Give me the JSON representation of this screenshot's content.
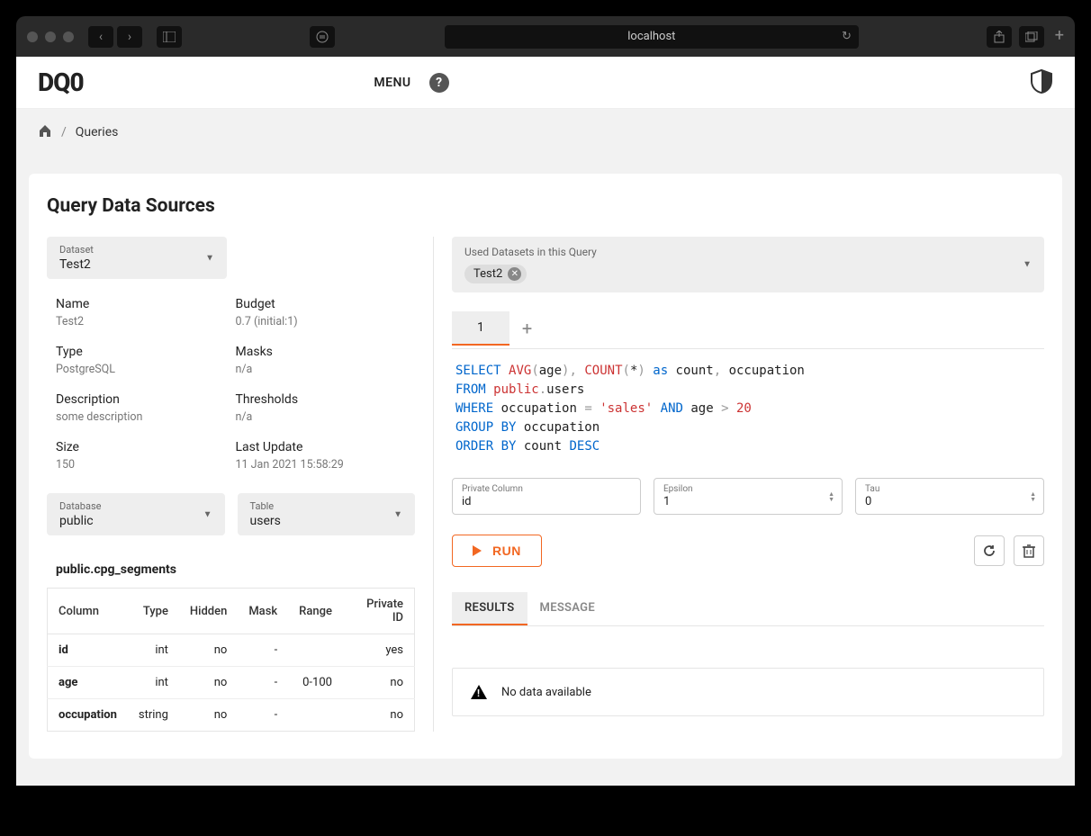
{
  "browser": {
    "url": "localhost"
  },
  "header": {
    "logo": "DQ0",
    "menu": "MENU"
  },
  "breadcrumb": {
    "current": "Queries"
  },
  "page_title": "Query Data Sources",
  "dataset_select": {
    "label": "Dataset",
    "value": "Test2"
  },
  "meta": {
    "name": {
      "label": "Name",
      "value": "Test2"
    },
    "budget": {
      "label": "Budget",
      "value": "0.7 (initial:1)"
    },
    "type": {
      "label": "Type",
      "value": "PostgreSQL"
    },
    "masks": {
      "label": "Masks",
      "value": "n/a"
    },
    "description": {
      "label": "Description",
      "value": "some description"
    },
    "thresholds": {
      "label": "Thresholds",
      "value": "n/a"
    },
    "size": {
      "label": "Size",
      "value": "150"
    },
    "last_update": {
      "label": "Last Update",
      "value": "11 Jan 2021 15:58:29"
    }
  },
  "db_select": {
    "label": "Database",
    "value": "public"
  },
  "table_select": {
    "label": "Table",
    "value": "users"
  },
  "schema_title": "public.cpg_segments",
  "schema_headers": [
    "Column",
    "Type",
    "Hidden",
    "Mask",
    "Range",
    "Private ID"
  ],
  "schema_rows": [
    {
      "c": "id",
      "t": "int",
      "h": "no",
      "m": "-",
      "r": "",
      "p": "yes"
    },
    {
      "c": "age",
      "t": "int",
      "h": "no",
      "m": "-",
      "r": "0-100",
      "p": "no"
    },
    {
      "c": "occupation",
      "t": "string",
      "h": "no",
      "m": "-",
      "r": "",
      "p": "no"
    }
  ],
  "used_datasets": {
    "label": "Used Datasets in this Query",
    "chips": [
      "Test2"
    ]
  },
  "query_tabs": [
    "1"
  ],
  "sql_tokens": [
    [
      "kw",
      "SELECT"
    ],
    [
      "sp",
      " "
    ],
    [
      "fn",
      "AVG"
    ],
    [
      "punc",
      "("
    ],
    [
      "txt",
      "age"
    ],
    [
      "punc",
      ")"
    ],
    [
      "punc",
      ","
    ],
    [
      "sp",
      " "
    ],
    [
      "fn",
      "COUNT"
    ],
    [
      "punc",
      "("
    ],
    [
      "txt",
      "*"
    ],
    [
      "punc",
      ")"
    ],
    [
      "sp",
      " "
    ],
    [
      "kw",
      "as"
    ],
    [
      "sp",
      " "
    ],
    [
      "txt",
      "count"
    ],
    [
      "punc",
      ","
    ],
    [
      "sp",
      " "
    ],
    [
      "txt",
      "occupation"
    ],
    [
      "nl"
    ],
    [
      "kw",
      "FROM"
    ],
    [
      "sp",
      " "
    ],
    [
      "fn",
      "public"
    ],
    [
      "punc",
      "."
    ],
    [
      "txt",
      "users"
    ],
    [
      "nl"
    ],
    [
      "kw",
      "WHERE"
    ],
    [
      "sp",
      " "
    ],
    [
      "txt",
      "occupation"
    ],
    [
      "sp",
      " "
    ],
    [
      "punc",
      "="
    ],
    [
      "sp",
      " "
    ],
    [
      "str",
      "'sales'"
    ],
    [
      "sp",
      " "
    ],
    [
      "kw",
      "AND"
    ],
    [
      "sp",
      " "
    ],
    [
      "txt",
      "age"
    ],
    [
      "sp",
      " "
    ],
    [
      "punc",
      ">"
    ],
    [
      "sp",
      " "
    ],
    [
      "num",
      "20"
    ],
    [
      "nl"
    ],
    [
      "kw",
      "GROUP"
    ],
    [
      "sp",
      " "
    ],
    [
      "kw",
      "BY"
    ],
    [
      "sp",
      " "
    ],
    [
      "txt",
      "occupation"
    ],
    [
      "nl"
    ],
    [
      "kw",
      "ORDER"
    ],
    [
      "sp",
      " "
    ],
    [
      "kw",
      "BY"
    ],
    [
      "sp",
      " "
    ],
    [
      "txt",
      "count"
    ],
    [
      "sp",
      " "
    ],
    [
      "kw",
      "DESC"
    ]
  ],
  "params": {
    "private_col": {
      "label": "Private Column",
      "value": "id"
    },
    "epsilon": {
      "label": "Epsilon",
      "value": "1"
    },
    "tau": {
      "label": "Tau",
      "value": "0"
    }
  },
  "run_label": "RUN",
  "result_tabs": {
    "results": "RESULTS",
    "message": "MESSAGE"
  },
  "no_data": "No data available"
}
